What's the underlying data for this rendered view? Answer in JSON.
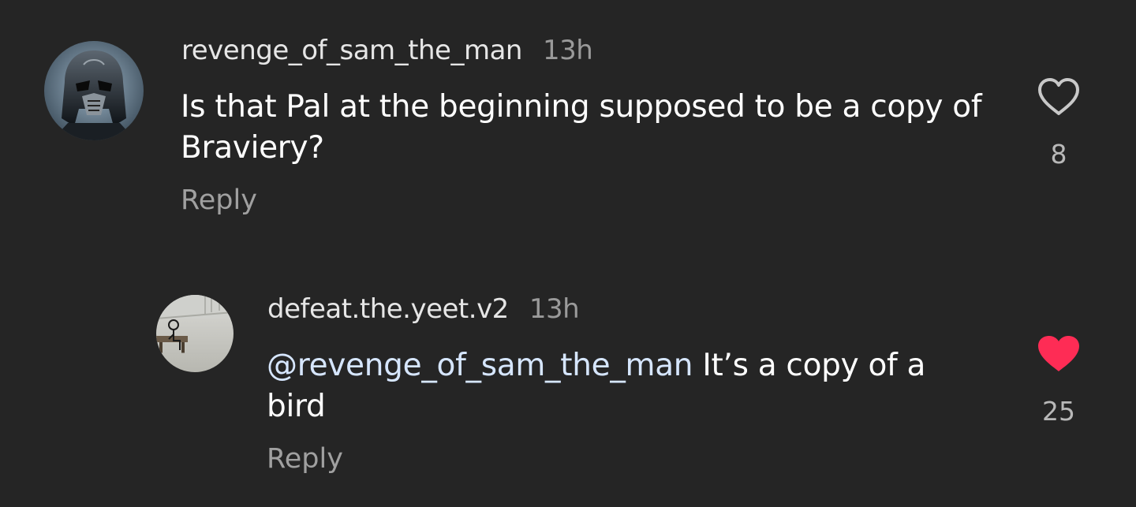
{
  "comments": [
    {
      "username": "revenge_of_sam_the_man",
      "time": "13h",
      "text": "Is that Pal at the beginning supposed to be a copy of Braviery?",
      "reply_label": "Reply",
      "likes": "8",
      "liked": false,
      "avatar_icon": "helmet-avatar"
    },
    {
      "username": "defeat.the.yeet.v2",
      "time": "13h",
      "mention": "@revenge_of_sam_the_man",
      "text": " It’s a copy of a bird",
      "reply_label": "Reply",
      "likes": "25",
      "liked": true,
      "avatar_icon": "stickfigure-avatar"
    }
  ],
  "colors": {
    "background": "#252525",
    "liked_heart": "#fe2c55",
    "unliked_heart": "#c8c8c8"
  }
}
